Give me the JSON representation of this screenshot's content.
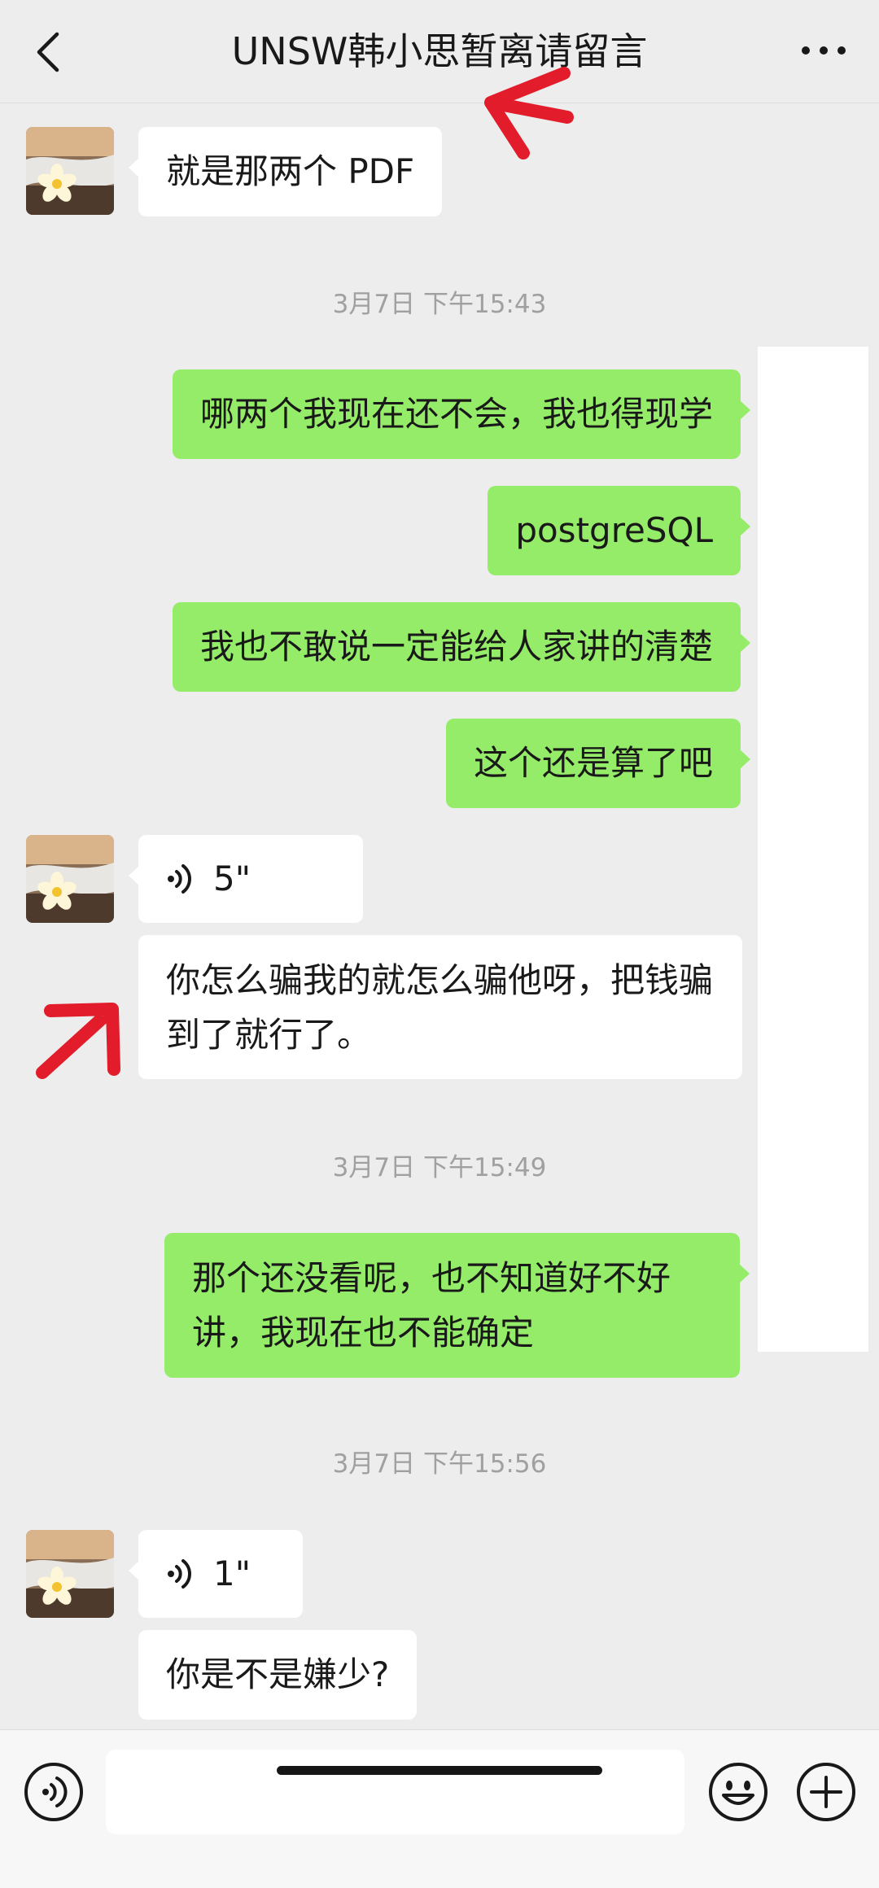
{
  "header": {
    "title": "UNSW韩小思暂离请留言"
  },
  "messages": [
    {
      "side": "in",
      "kind": "text",
      "text": "就是那两个 PDF"
    },
    {
      "kind": "time",
      "text": "3月7日 下午15:43"
    },
    {
      "side": "out",
      "kind": "text",
      "text": "哪两个我现在还不会，我也得现学"
    },
    {
      "side": "out",
      "kind": "text",
      "text": "postgreSQL"
    },
    {
      "side": "out",
      "kind": "text",
      "text": "我也不敢说一定能给人家讲的清楚"
    },
    {
      "side": "out",
      "kind": "text",
      "text": "这个还是算了吧"
    },
    {
      "side": "in",
      "kind": "voice",
      "duration": "5\""
    },
    {
      "side": "in",
      "kind": "text",
      "text": "你怎么骗我的就怎么骗他呀，把钱骗到了就行了。"
    },
    {
      "kind": "time",
      "text": "3月7日 下午15:49"
    },
    {
      "side": "out",
      "kind": "text",
      "text": "那个还没看呢，也不知道好不好讲，我现在也不能确定"
    },
    {
      "kind": "time",
      "text": "3月7日 下午15:56"
    },
    {
      "side": "in",
      "kind": "voice",
      "duration": "1\""
    },
    {
      "side": "in",
      "kind": "text",
      "text": "你是不是嫌少?"
    }
  ],
  "input": {
    "value": ""
  },
  "icons": {
    "back": "chevron-left-icon",
    "more": "more-dots-icon",
    "voice_toggle": "voice-icon",
    "emoji": "emoji-icon",
    "plus": "plus-icon"
  },
  "colors": {
    "background": "#ededed",
    "incoming_bubble": "#ffffff",
    "outgoing_bubble": "#95ec69",
    "annotation_arrow": "#e21c2b"
  }
}
